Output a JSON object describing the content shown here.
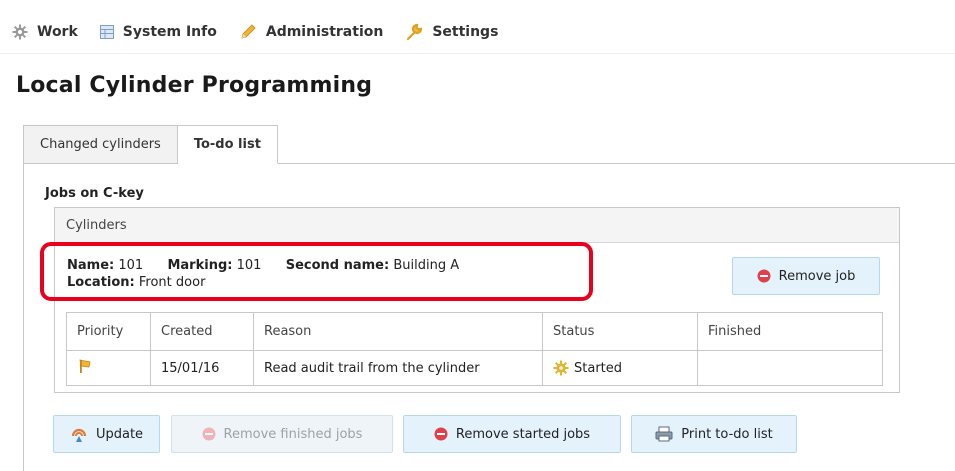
{
  "menu": {
    "items": [
      {
        "label": "Work",
        "icon": "gear-icon"
      },
      {
        "label": "System Info",
        "icon": "table-icon"
      },
      {
        "label": "Administration",
        "icon": "pencil-icon"
      },
      {
        "label": "Settings",
        "icon": "wrench-icon"
      }
    ]
  },
  "page": {
    "title": "Local Cylinder Programming"
  },
  "tabs": [
    {
      "label": "Changed cylinders",
      "active": false
    },
    {
      "label": "To-do list",
      "active": true
    }
  ],
  "jobs": {
    "section_title": "Jobs on C-key",
    "box_header": "Cylinders",
    "cylinder": {
      "name_label": "Name:",
      "name_value": "101",
      "marking_label": "Marking:",
      "marking_value": "101",
      "second_name_label": "Second name:",
      "second_name_value": "Building A",
      "location_label": "Location:",
      "location_value": "Front door"
    },
    "remove_job_label": "Remove job",
    "table": {
      "headers": [
        "Priority",
        "Created",
        "Reason",
        "Status",
        "Finished"
      ],
      "rows": [
        {
          "priority_icon": "flag-icon",
          "created": "15/01/16",
          "reason": "Read audit trail from the cylinder",
          "status": "Started",
          "status_icon": "gear-icon",
          "finished": ""
        }
      ]
    }
  },
  "actions": {
    "update": "Update",
    "remove_finished": "Remove finished jobs",
    "remove_started": "Remove started jobs",
    "print_todo": "Print to-do list"
  },
  "colors": {
    "highlight": "#e8001c",
    "button_bg": "#e4f2fb",
    "remove_icon": "#e0404a"
  }
}
